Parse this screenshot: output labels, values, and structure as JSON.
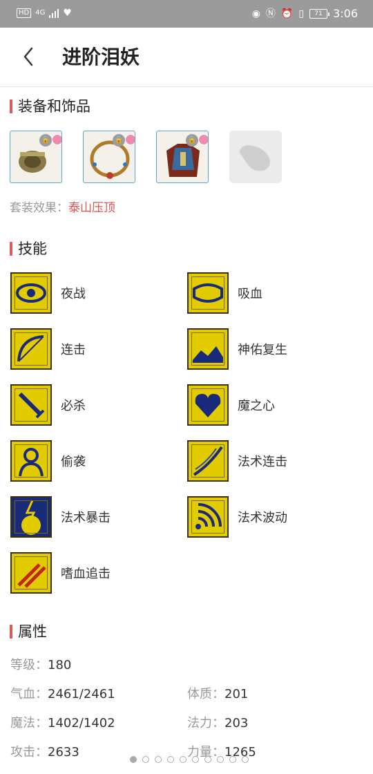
{
  "status_bar": {
    "left_badges": [
      "HD",
      "4G"
    ],
    "time": "3:06",
    "battery": "71"
  },
  "header": {
    "title": "进阶泪妖",
    "back_icon": "chevron-left-icon"
  },
  "equipment": {
    "section_title": "装备和饰品",
    "items": [
      {
        "icon": "bracer-icon"
      },
      {
        "icon": "necklace-icon"
      },
      {
        "icon": "armor-icon"
      },
      {
        "icon": "empty-slot-icon"
      }
    ],
    "set_label": "套装效果：",
    "set_value": "泰山压顶"
  },
  "skills": {
    "section_title": "技能",
    "items": [
      {
        "label": "夜战",
        "icon": "eye-skill-icon"
      },
      {
        "label": "吸血",
        "icon": "lips-skill-icon"
      },
      {
        "label": "连击",
        "icon": "bow-skill-icon"
      },
      {
        "label": "神佑复生",
        "icon": "revive-skill-icon"
      },
      {
        "label": "必杀",
        "icon": "sword-skill-icon"
      },
      {
        "label": "魔之心",
        "icon": "heart-skill-icon"
      },
      {
        "label": "偷袭",
        "icon": "sneak-skill-icon"
      },
      {
        "label": "法术连击",
        "icon": "magic-combo-skill-icon"
      },
      {
        "label": "法术暴击",
        "icon": "magic-crit-skill-icon"
      },
      {
        "label": "法术波动",
        "icon": "magic-wave-skill-icon"
      },
      {
        "label": "嗜血追击",
        "icon": "blood-chase-skill-icon"
      }
    ]
  },
  "attributes": {
    "section_title": "属性",
    "level": {
      "label": "等级：",
      "value": "180"
    },
    "hp": {
      "label": "气血：",
      "value": "2461/2461"
    },
    "constitution": {
      "label": "体质：",
      "value": "201"
    },
    "mp": {
      "label": "魔法：",
      "value": "1402/1402"
    },
    "magic": {
      "label": "法力：",
      "value": "203"
    },
    "attack": {
      "label": "攻击：",
      "value": "2633"
    },
    "strength": {
      "label": "力量：",
      "value": "1265"
    }
  },
  "pager": {
    "count": 10,
    "active_index": 0
  }
}
